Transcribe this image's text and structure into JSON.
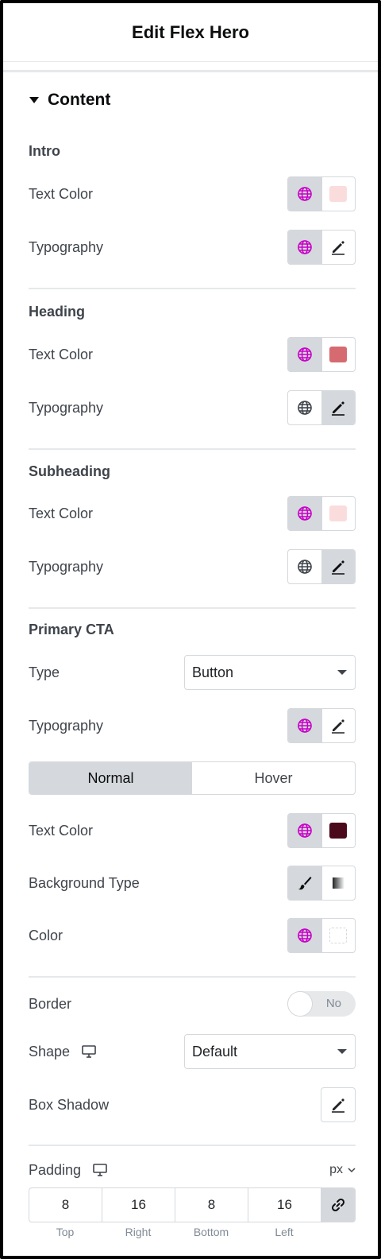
{
  "header": {
    "title": "Edit Flex Hero"
  },
  "content": {
    "title": "Content"
  },
  "labels": {
    "text_color": "Text Color",
    "typography": "Typography"
  },
  "sections": {
    "intro": {
      "title": "Intro",
      "text_color_swatch": "#fadcdc"
    },
    "heading": {
      "title": "Heading",
      "text_color_swatch": "#d56b70"
    },
    "subheading": {
      "title": "Subheading",
      "text_color_swatch": "#fadcdc"
    },
    "primary_cta": {
      "title": "Primary CTA",
      "type_label": "Type",
      "type_value": "Button",
      "tabs": {
        "normal": "Normal",
        "hover": "Hover"
      },
      "text_color_swatch": "#4a0a1c",
      "background_type_label": "Background Type",
      "color_label": "Color"
    }
  },
  "border": {
    "label": "Border",
    "toggle_text": "No"
  },
  "shape": {
    "label": "Shape",
    "value": "Default"
  },
  "box_shadow": {
    "label": "Box Shadow"
  },
  "padding": {
    "label": "Padding",
    "unit": "px",
    "values": {
      "top": "8",
      "right": "16",
      "bottom": "8",
      "left": "16"
    },
    "sides": {
      "top": "Top",
      "right": "Right",
      "bottom": "Bottom",
      "left": "Left"
    }
  },
  "colors": {
    "global_icon": "#c800c8",
    "panel_grey": "#d5d8dc"
  }
}
